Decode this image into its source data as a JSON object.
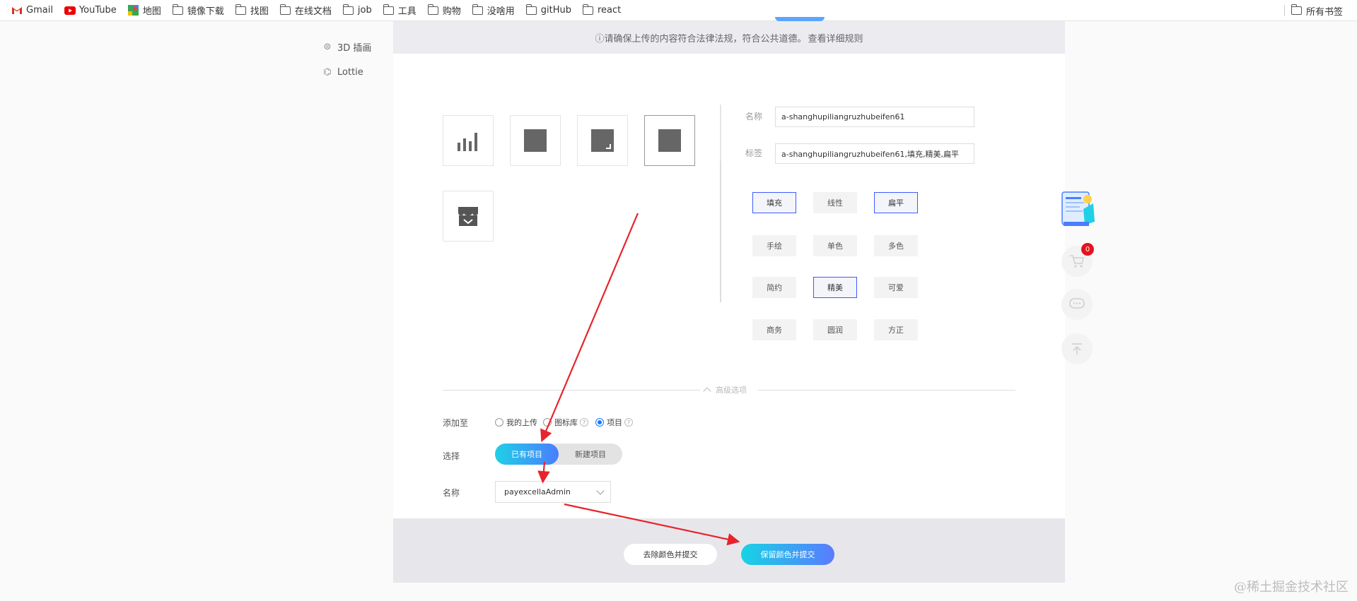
{
  "bookmarks": {
    "items": [
      {
        "label": "Gmail",
        "icon": "gmail-icon"
      },
      {
        "label": "YouTube",
        "icon": "youtube-icon"
      },
      {
        "label": "地图",
        "icon": "maps-icon"
      },
      {
        "label": "镜像下载",
        "icon": "folder-icon"
      },
      {
        "label": "找图",
        "icon": "folder-icon"
      },
      {
        "label": "在线文档",
        "icon": "folder-icon"
      },
      {
        "label": "job",
        "icon": "folder-icon"
      },
      {
        "label": "工具",
        "icon": "folder-icon"
      },
      {
        "label": "购物",
        "icon": "folder-icon"
      },
      {
        "label": "没啥用",
        "icon": "folder-icon"
      },
      {
        "label": "gitHub",
        "icon": "folder-icon"
      },
      {
        "label": "react",
        "icon": "folder-icon"
      }
    ],
    "all_bookmarks": "所有书签"
  },
  "sidenav": {
    "items": [
      {
        "label": "3D 插画",
        "icon": "globe-icon"
      },
      {
        "label": "Lottie",
        "icon": "lottie-icon"
      }
    ]
  },
  "notice": {
    "text": "ⓘ请确保上传的内容符合法律法规，符合公共道德。",
    "link": "查看详细规则"
  },
  "form": {
    "name_label": "名称",
    "name_value": "a-shanghupiliangruzhubeifen61",
    "tags_label": "标签",
    "tags_value": "a-shanghupiliangruzhubeifen61,填充,精美,扁平",
    "style_tags": [
      {
        "label": "填充",
        "active": true
      },
      {
        "label": "线性",
        "active": false
      },
      {
        "label": "扁平",
        "active": true
      },
      {
        "label": "手绘",
        "active": false
      },
      {
        "label": "单色",
        "active": false
      },
      {
        "label": "多色",
        "active": false
      },
      {
        "label": "简约",
        "active": false
      },
      {
        "label": "精美",
        "active": true
      },
      {
        "label": "可爱",
        "active": false
      },
      {
        "label": "商务",
        "active": false
      },
      {
        "label": "圆润",
        "active": false
      },
      {
        "label": "方正",
        "active": false
      }
    ],
    "advanced_label": "高级选项"
  },
  "upload_target": {
    "add_to_label": "添加至",
    "options": [
      "我的上传",
      "图标库",
      "项目"
    ],
    "selected_option": "项目",
    "choose_label": "选择",
    "segments": [
      "已有项目",
      "新建项目"
    ],
    "selected_segment": "已有项目",
    "project_name_label": "名称",
    "project_name_value": "payexcellaAdmin"
  },
  "actions": {
    "remove_color": "去除颜色并提交",
    "keep_color": "保留颜色并提交"
  },
  "floating": {
    "cart_count": "0"
  },
  "watermark": "@稀土掘金技术社区",
  "colors": {
    "accent_start": "#16d3e4",
    "accent_end": "#5a7bff",
    "tag_active_border": "#3d5afe",
    "arrow": "#e8232b",
    "badge": "#e5141c"
  }
}
